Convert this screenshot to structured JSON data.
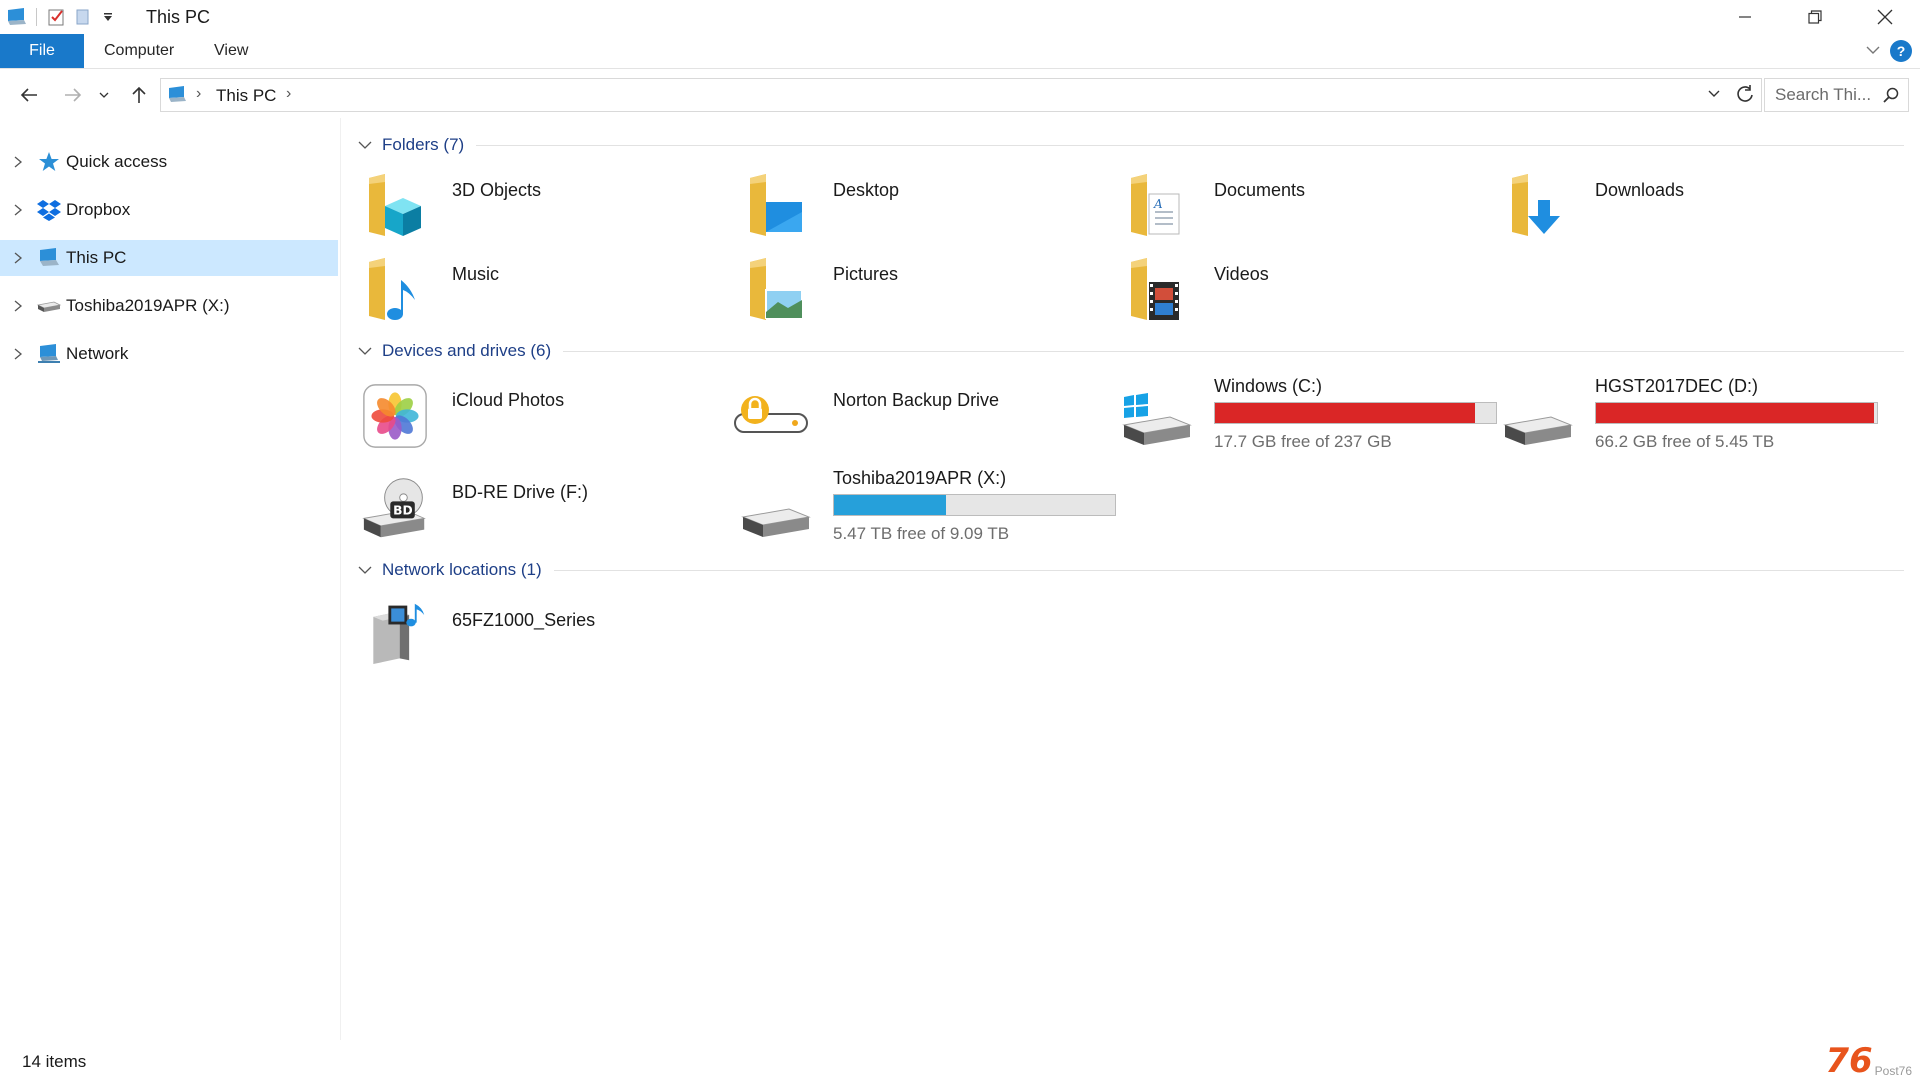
{
  "window": {
    "title": "This PC",
    "controls": [
      "minimize-icon",
      "restore-icon",
      "close-icon"
    ]
  },
  "ribbon": {
    "tabs": [
      {
        "label": "File",
        "active": true
      },
      {
        "label": "Computer"
      },
      {
        "label": "View"
      }
    ],
    "help_label": "?"
  },
  "address": {
    "crumb": "This PC",
    "search_placeholder": "Search Thi..."
  },
  "sidebar": {
    "items": [
      {
        "label": "Quick access",
        "icon": "star-icon"
      },
      {
        "label": "Dropbox",
        "icon": "dropbox-icon"
      },
      {
        "label": "This PC",
        "icon": "computer-icon",
        "selected": true
      },
      {
        "label": "Toshiba2019APR (X:)",
        "icon": "drive-icon"
      },
      {
        "label": "Network",
        "icon": "network-icon"
      }
    ]
  },
  "groups": {
    "folders": {
      "label": "Folders (7)",
      "items": [
        {
          "label": "3D Objects",
          "icon": "3d-objects-folder-icon"
        },
        {
          "label": "Desktop",
          "icon": "desktop-folder-icon"
        },
        {
          "label": "Documents",
          "icon": "documents-folder-icon"
        },
        {
          "label": "Downloads",
          "icon": "downloads-folder-icon"
        },
        {
          "label": "Music",
          "icon": "music-folder-icon"
        },
        {
          "label": "Pictures",
          "icon": "pictures-folder-icon"
        },
        {
          "label": "Videos",
          "icon": "videos-folder-icon"
        }
      ]
    },
    "devices": {
      "label": "Devices and drives (6)",
      "items": [
        {
          "label": "iCloud Photos",
          "icon": "icloud-photos-icon"
        },
        {
          "label": "Norton Backup Drive",
          "icon": "norton-backup-icon"
        },
        {
          "label": "Windows (C:)",
          "icon": "windows-drive-icon",
          "free_text": "17.7 GB free of 237 GB",
          "used_fraction": 0.925,
          "bar_color": "#da2626"
        },
        {
          "label": "HGST2017DEC (D:)",
          "icon": "hard-drive-icon",
          "free_text": "66.2 GB free of 5.45 TB",
          "used_fraction": 0.988,
          "bar_color": "#da2626"
        },
        {
          "label": "BD-RE Drive (F:)",
          "icon": "bd-drive-icon",
          "disc_label": "BD"
        },
        {
          "label": "Toshiba2019APR (X:)",
          "icon": "hard-drive-icon",
          "free_text": "5.47 TB free of 9.09 TB",
          "used_fraction": 0.398,
          "bar_color": "#26a0da"
        }
      ]
    },
    "network": {
      "label": "Network locations (1)",
      "items": [
        {
          "label": "65FZ1000_Series",
          "icon": "media-server-icon"
        }
      ]
    }
  },
  "status": {
    "items_count": "14 items"
  },
  "watermark": {
    "big": "76",
    "small": "Post76"
  },
  "colors": {
    "accent": "#1979ca",
    "selection": "#cce8ff",
    "group_header": "#1e3f87",
    "bar_red": "#da2626",
    "bar_blue": "#26a0da"
  }
}
